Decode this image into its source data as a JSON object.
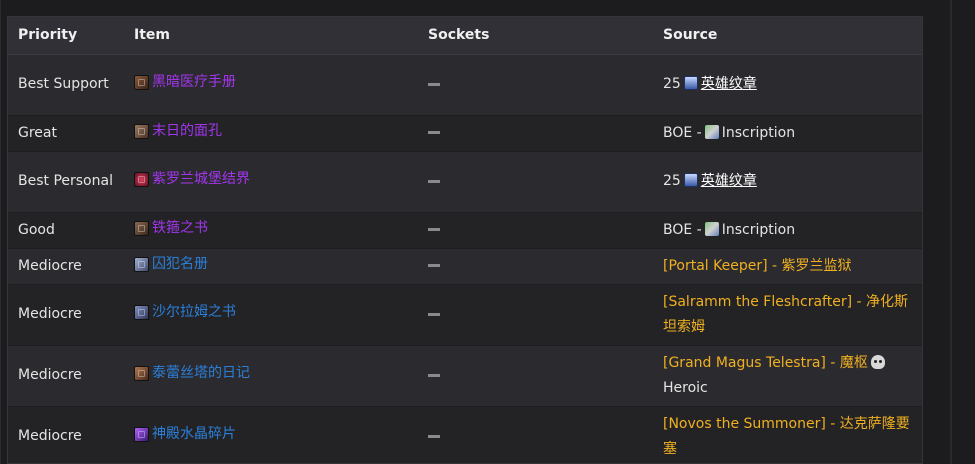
{
  "table": {
    "headers": [
      "Priority",
      "Item",
      "Sockets",
      "Source"
    ],
    "rows": [
      {
        "priority": "Best Support",
        "item": "黑暗医疗手册",
        "item_color": "purple",
        "item_icon": "tome-icon",
        "sockets": "—",
        "source_prefix": "25",
        "source_link": "英雄纹章",
        "source_type": "badge"
      },
      {
        "priority": "Great",
        "item": "末日的面孔",
        "item_color": "purple",
        "item_icon": "face-icon",
        "sockets": "—",
        "source_prefix": "BOE -",
        "source_link": "Inscription",
        "source_type": "inscription"
      },
      {
        "priority": "Best Personal",
        "item": "紫罗兰城堡结界",
        "item_color": "purple",
        "item_icon": "shield-icon",
        "sockets": "—",
        "source_prefix": "25",
        "source_link": "英雄纹章",
        "source_type": "badge"
      },
      {
        "priority": "Good",
        "item": "铁箍之书",
        "item_color": "purple",
        "item_icon": "book-icon",
        "sockets": "—",
        "source_prefix": "BOE -",
        "source_link": "Inscription",
        "source_type": "inscription"
      },
      {
        "priority": "Mediocre",
        "item": "囚犯名册",
        "item_color": "blue",
        "item_icon": "ledger-icon",
        "sockets": "—",
        "source_text": "[Portal Keeper] - 紫罗兰监狱",
        "source_type": "boss"
      },
      {
        "priority": "Mediocre",
        "item": "沙尔拉姆之书",
        "item_color": "blue",
        "item_icon": "tome-icon",
        "sockets": "—",
        "source_text": "[Salramm the Fleshcrafter] - 净化斯坦索姆",
        "source_type": "boss"
      },
      {
        "priority": "Mediocre",
        "item": "泰蕾丝塔的日记",
        "item_color": "blue",
        "item_icon": "diary-icon",
        "sockets": "—",
        "source_text": "[Grand Magus Telestra] - 魔枢",
        "source_suffix": "Heroic",
        "source_type": "boss-heroic"
      },
      {
        "priority": "Mediocre",
        "item": "神殿水晶碎片",
        "item_color": "blue",
        "item_icon": "crystal-icon",
        "sockets": "—",
        "source_text": "[Novos the Summoner] - 达克萨隆要塞",
        "source_type": "boss"
      }
    ]
  }
}
